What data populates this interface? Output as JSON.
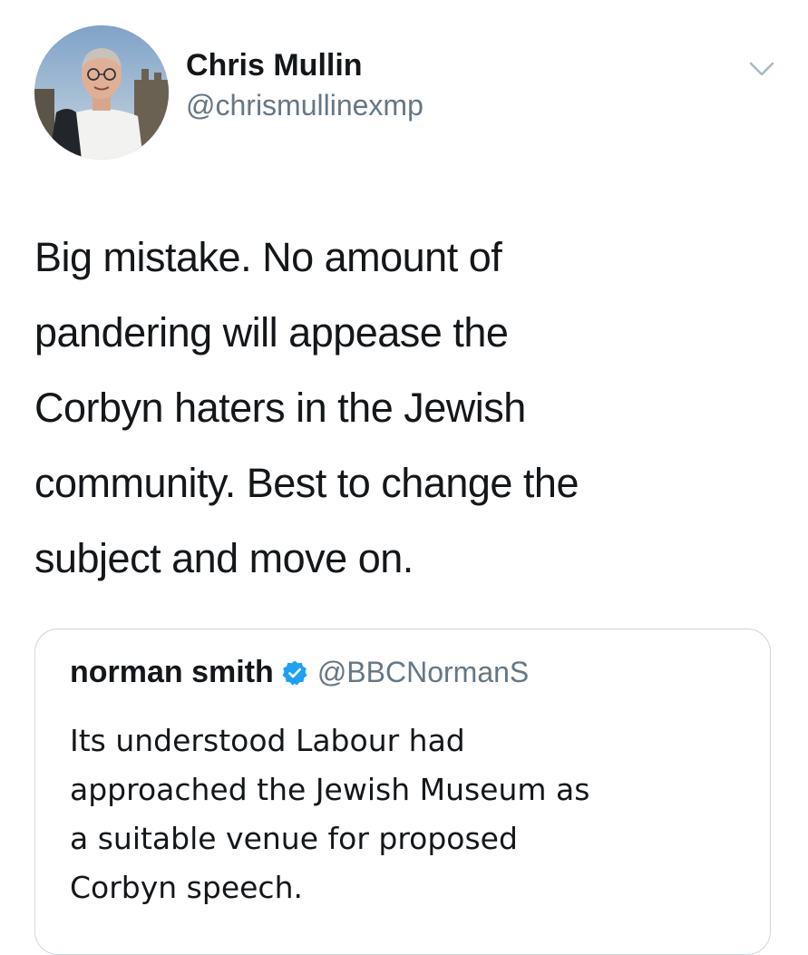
{
  "tweet": {
    "author": {
      "name": "Chris Mullin",
      "handle": "@chrismullinexmp"
    },
    "text_lines": [
      "Big mistake.  No amount of",
      "pandering will appease the",
      "Corbyn haters in the Jewish",
      "community.  Best to change the",
      "subject and move on."
    ],
    "menu_icon": "chevron-down-icon"
  },
  "quoted_tweet": {
    "author": {
      "name": "norman smith",
      "handle": "@BBCNormanS",
      "verified": true
    },
    "text_lines": [
      "Its understood Labour had",
      "approached the Jewish Museum as",
      "a suitable venue for proposed",
      "Corbyn speech."
    ],
    "verified_icon": "verified-badge-icon"
  },
  "colors": {
    "text": "#14171a",
    "secondary": "#657786",
    "border": "#ccd6dd",
    "verified": "#1da1f2"
  }
}
